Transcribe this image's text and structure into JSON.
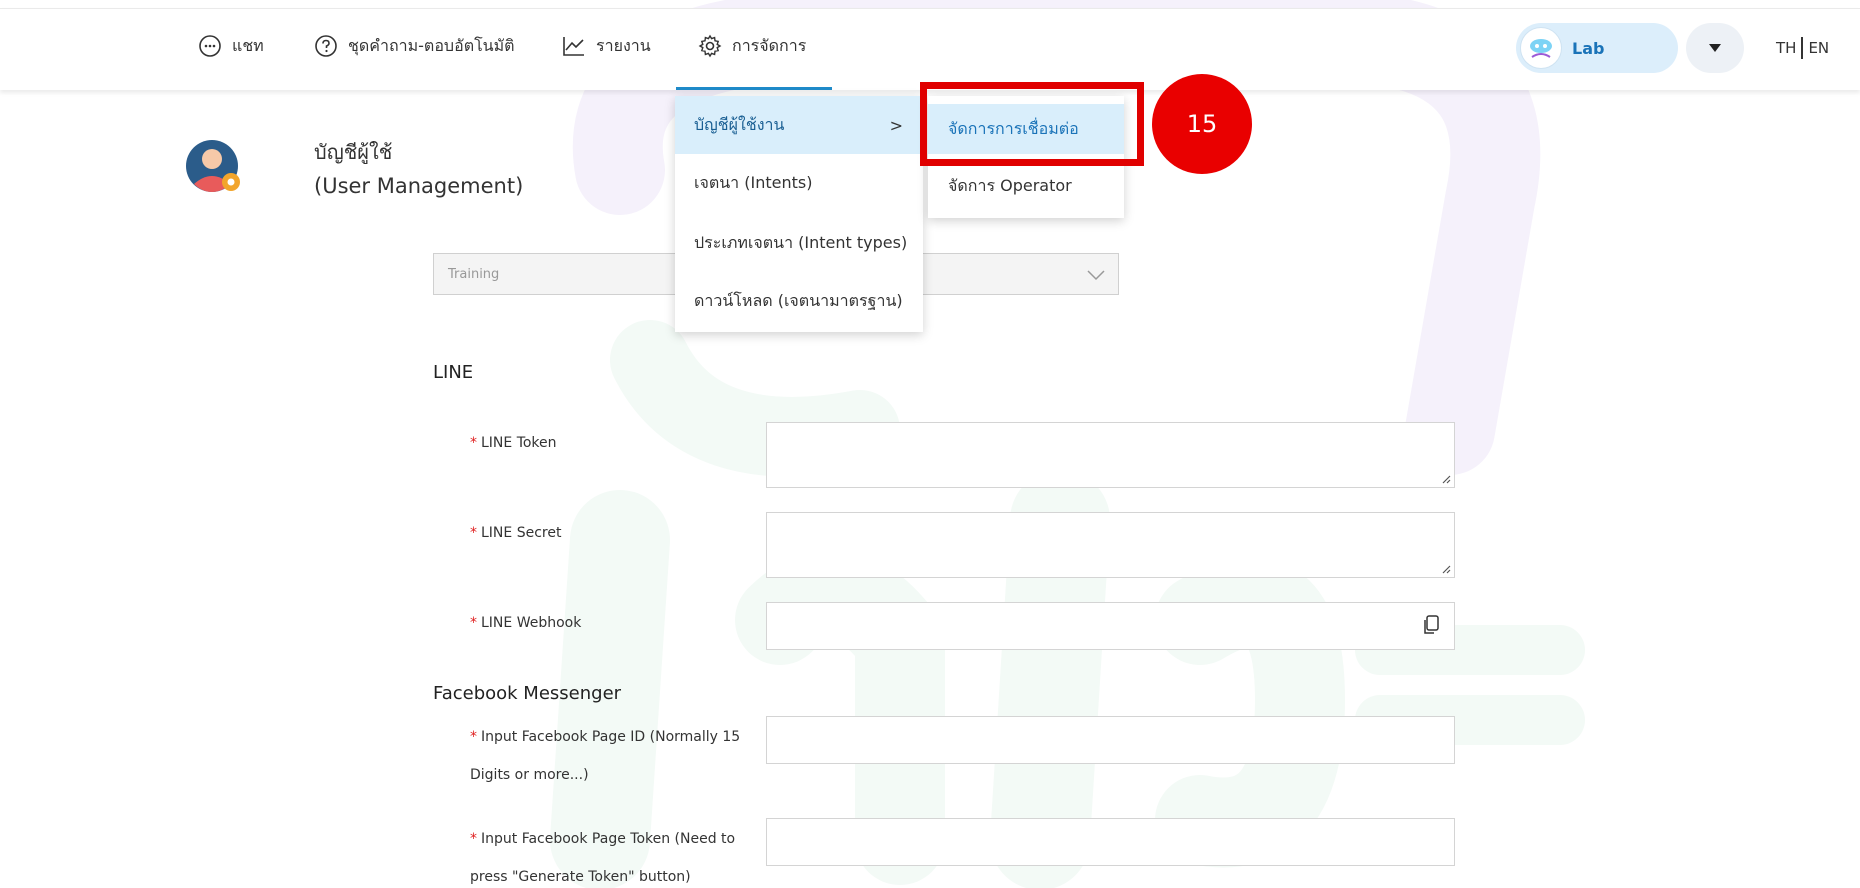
{
  "nav": {
    "items": [
      {
        "label": "แชท",
        "icon": "chat-bubble-icon"
      },
      {
        "label": "ชุดคำถาม-ตอบอัตโนมัติ",
        "icon": "question-circle-icon"
      },
      {
        "label": "รายงาน",
        "icon": "line-chart-icon"
      },
      {
        "label": "การจัดการ",
        "icon": "gear-icon"
      }
    ],
    "active_index": 3
  },
  "account": {
    "name": "Lab",
    "dropdown_icon": "caret-down-icon"
  },
  "language": {
    "th": "TH",
    "en": "EN"
  },
  "page": {
    "title_th": "บัญชีผู้ใช้",
    "title_en": "(User Management)"
  },
  "bot_select": {
    "value": "Training"
  },
  "menu": {
    "items": [
      {
        "label": "บัญชีผู้ใช้งาน",
        "arrow": ">"
      },
      {
        "label": "เจตนา (Intents)"
      },
      {
        "label": "ประเภทเจตนา (Intent types)"
      },
      {
        "label": "ดาวน์โหลด (เจตนามาตรฐาน)"
      }
    ],
    "submenu": [
      {
        "label": "จัดการการเชื่อมต่อ"
      },
      {
        "label": "จัดการ Operator"
      }
    ]
  },
  "annotation": {
    "step": "15",
    "color": "#e90000"
  },
  "form": {
    "required_mark": "*",
    "line": {
      "title": "LINE",
      "token_label": "LINE Token",
      "secret_label": "LINE Secret",
      "webhook_label": "LINE Webhook"
    },
    "facebook": {
      "title": "Facebook Messenger",
      "page_id_label_1": "Input Facebook Page ID (Normally 15",
      "page_id_label_2": "Digits or more...)",
      "page_token_label_1": "Input Facebook Page Token (Need to",
      "page_token_label_2": "press \"Generate Token\" button)"
    }
  },
  "colors": {
    "accent": "#1f8ac9",
    "active_bg": "#d9eefb",
    "required": "#e02020"
  }
}
